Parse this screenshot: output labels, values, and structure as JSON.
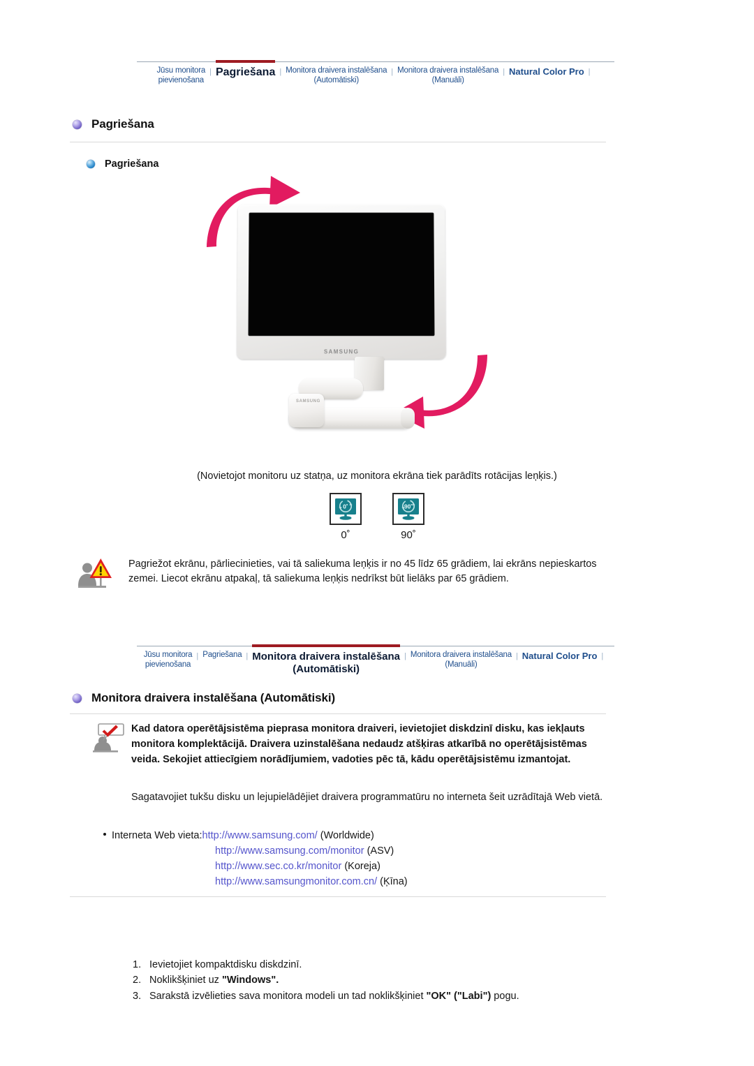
{
  "nav_top": {
    "items": [
      {
        "label": "Jūsu monitora\npievienošana",
        "active": false,
        "style": "small"
      },
      {
        "label": "Pagriešana",
        "active": true,
        "style": "lg"
      },
      {
        "label": "Monitora draivera instalēšana\n(Automātiski)",
        "active": false,
        "style": "small"
      },
      {
        "label": "Monitora draivera instalēšana\n(Manuāli)",
        "active": false,
        "style": "small"
      },
      {
        "label": "Natural Color Pro",
        "active": false,
        "style": "brand"
      }
    ],
    "separator": "|",
    "accent_color": "#9e1b22",
    "link_color": "#1f4e8c"
  },
  "nav_bottom": {
    "items": [
      {
        "label": "Jūsu monitora\npievienošana",
        "active": false,
        "style": "small"
      },
      {
        "label": "Pagriešana",
        "active": false,
        "style": "small"
      },
      {
        "label": "Monitora draivera instalēšana\n(Automātiski)",
        "active": true,
        "style": "md"
      },
      {
        "label": "Monitora draivera instalēšana\n(Manuāli)",
        "active": false,
        "style": "small"
      },
      {
        "label": "Natural Color Pro",
        "active": false,
        "style": "brand"
      }
    ],
    "separator": "|",
    "accent_color": "#9e1b22",
    "link_color": "#1f4e8c"
  },
  "section_rotate": {
    "heading": "Pagriešana",
    "subheading": "Pagriešana",
    "monitor_brand": "SAMSUNG",
    "monitor_base_brand": "SAMSUNG",
    "caption": "(Novietojot monitoru uz statņa, uz monitora ekrāna tiek parādīts rotācijas leņķis.)",
    "angles": [
      {
        "icon_text": "0˚",
        "label": "0˚"
      },
      {
        "icon_text": "90˚",
        "label": "90˚"
      }
    ],
    "warning": "Pagriežot ekrānu, pārliecinieties, vai tā saliekuma leņķis ir no 45 līdz 65 grādiem, lai ekrāns nepieskartos zemei. Liecot ekrānu atpakaļ, tā saliekuma leņķis nedrīkst būt lielāks par 65 grādiem."
  },
  "section_driver": {
    "heading": "Monitora draivera instalēšana (Automātiski)",
    "note_bold": "Kad datora operētājsistēma pieprasa monitora draiveri, ievietojiet diskdzinī disku, kas iekļauts monitora komplektācijā. Draivera uzinstalēšana nedaudz atšķiras atkarībā no operētājsistēmas veida. Sekojiet attiecīgiem norādījumiem, vadoties pēc tā, kādu operētājsistēmu izmantojat.",
    "paragraph": "Sagatavojiet tukšu disku un lejupielādējiet draivera programmatūru no interneta šeit uzrādītajā Web vietā.",
    "links_label": "Interneta Web vieta:",
    "links": [
      {
        "url": "http://www.samsung.com/",
        "region": "(Worldwide)"
      },
      {
        "url": "http://www.samsung.com/monitor",
        "region": "(ASV)"
      },
      {
        "url": "http://www.sec.co.kr/monitor",
        "region": "(Koreja)"
      },
      {
        "url": "http://www.samsungmonitor.com.cn/",
        "region": "(Ķīna)"
      }
    ],
    "link_color": "#5555cc",
    "steps": [
      {
        "num": "1.",
        "pre": "Ievietojiet kompaktdisku diskdzinī.",
        "bold": "",
        "post": ""
      },
      {
        "num": "2.",
        "pre": "Noklikšķiniet uz ",
        "bold": "\"Windows\".",
        "post": ""
      },
      {
        "num": "3.",
        "pre": "Sarakstā izvēlieties sava monitora modeli un tad noklikšķiniet ",
        "bold": "\"OK\" (\"Labi\")",
        "post": " pogu."
      }
    ]
  },
  "icons": {
    "warning": "warning-person-icon",
    "note": "note-person-icon",
    "bullet_main": "purple-sphere-bullet",
    "bullet_sub": "blue-sphere-bullet",
    "angle_icon": "monitor-rotation-icon"
  }
}
